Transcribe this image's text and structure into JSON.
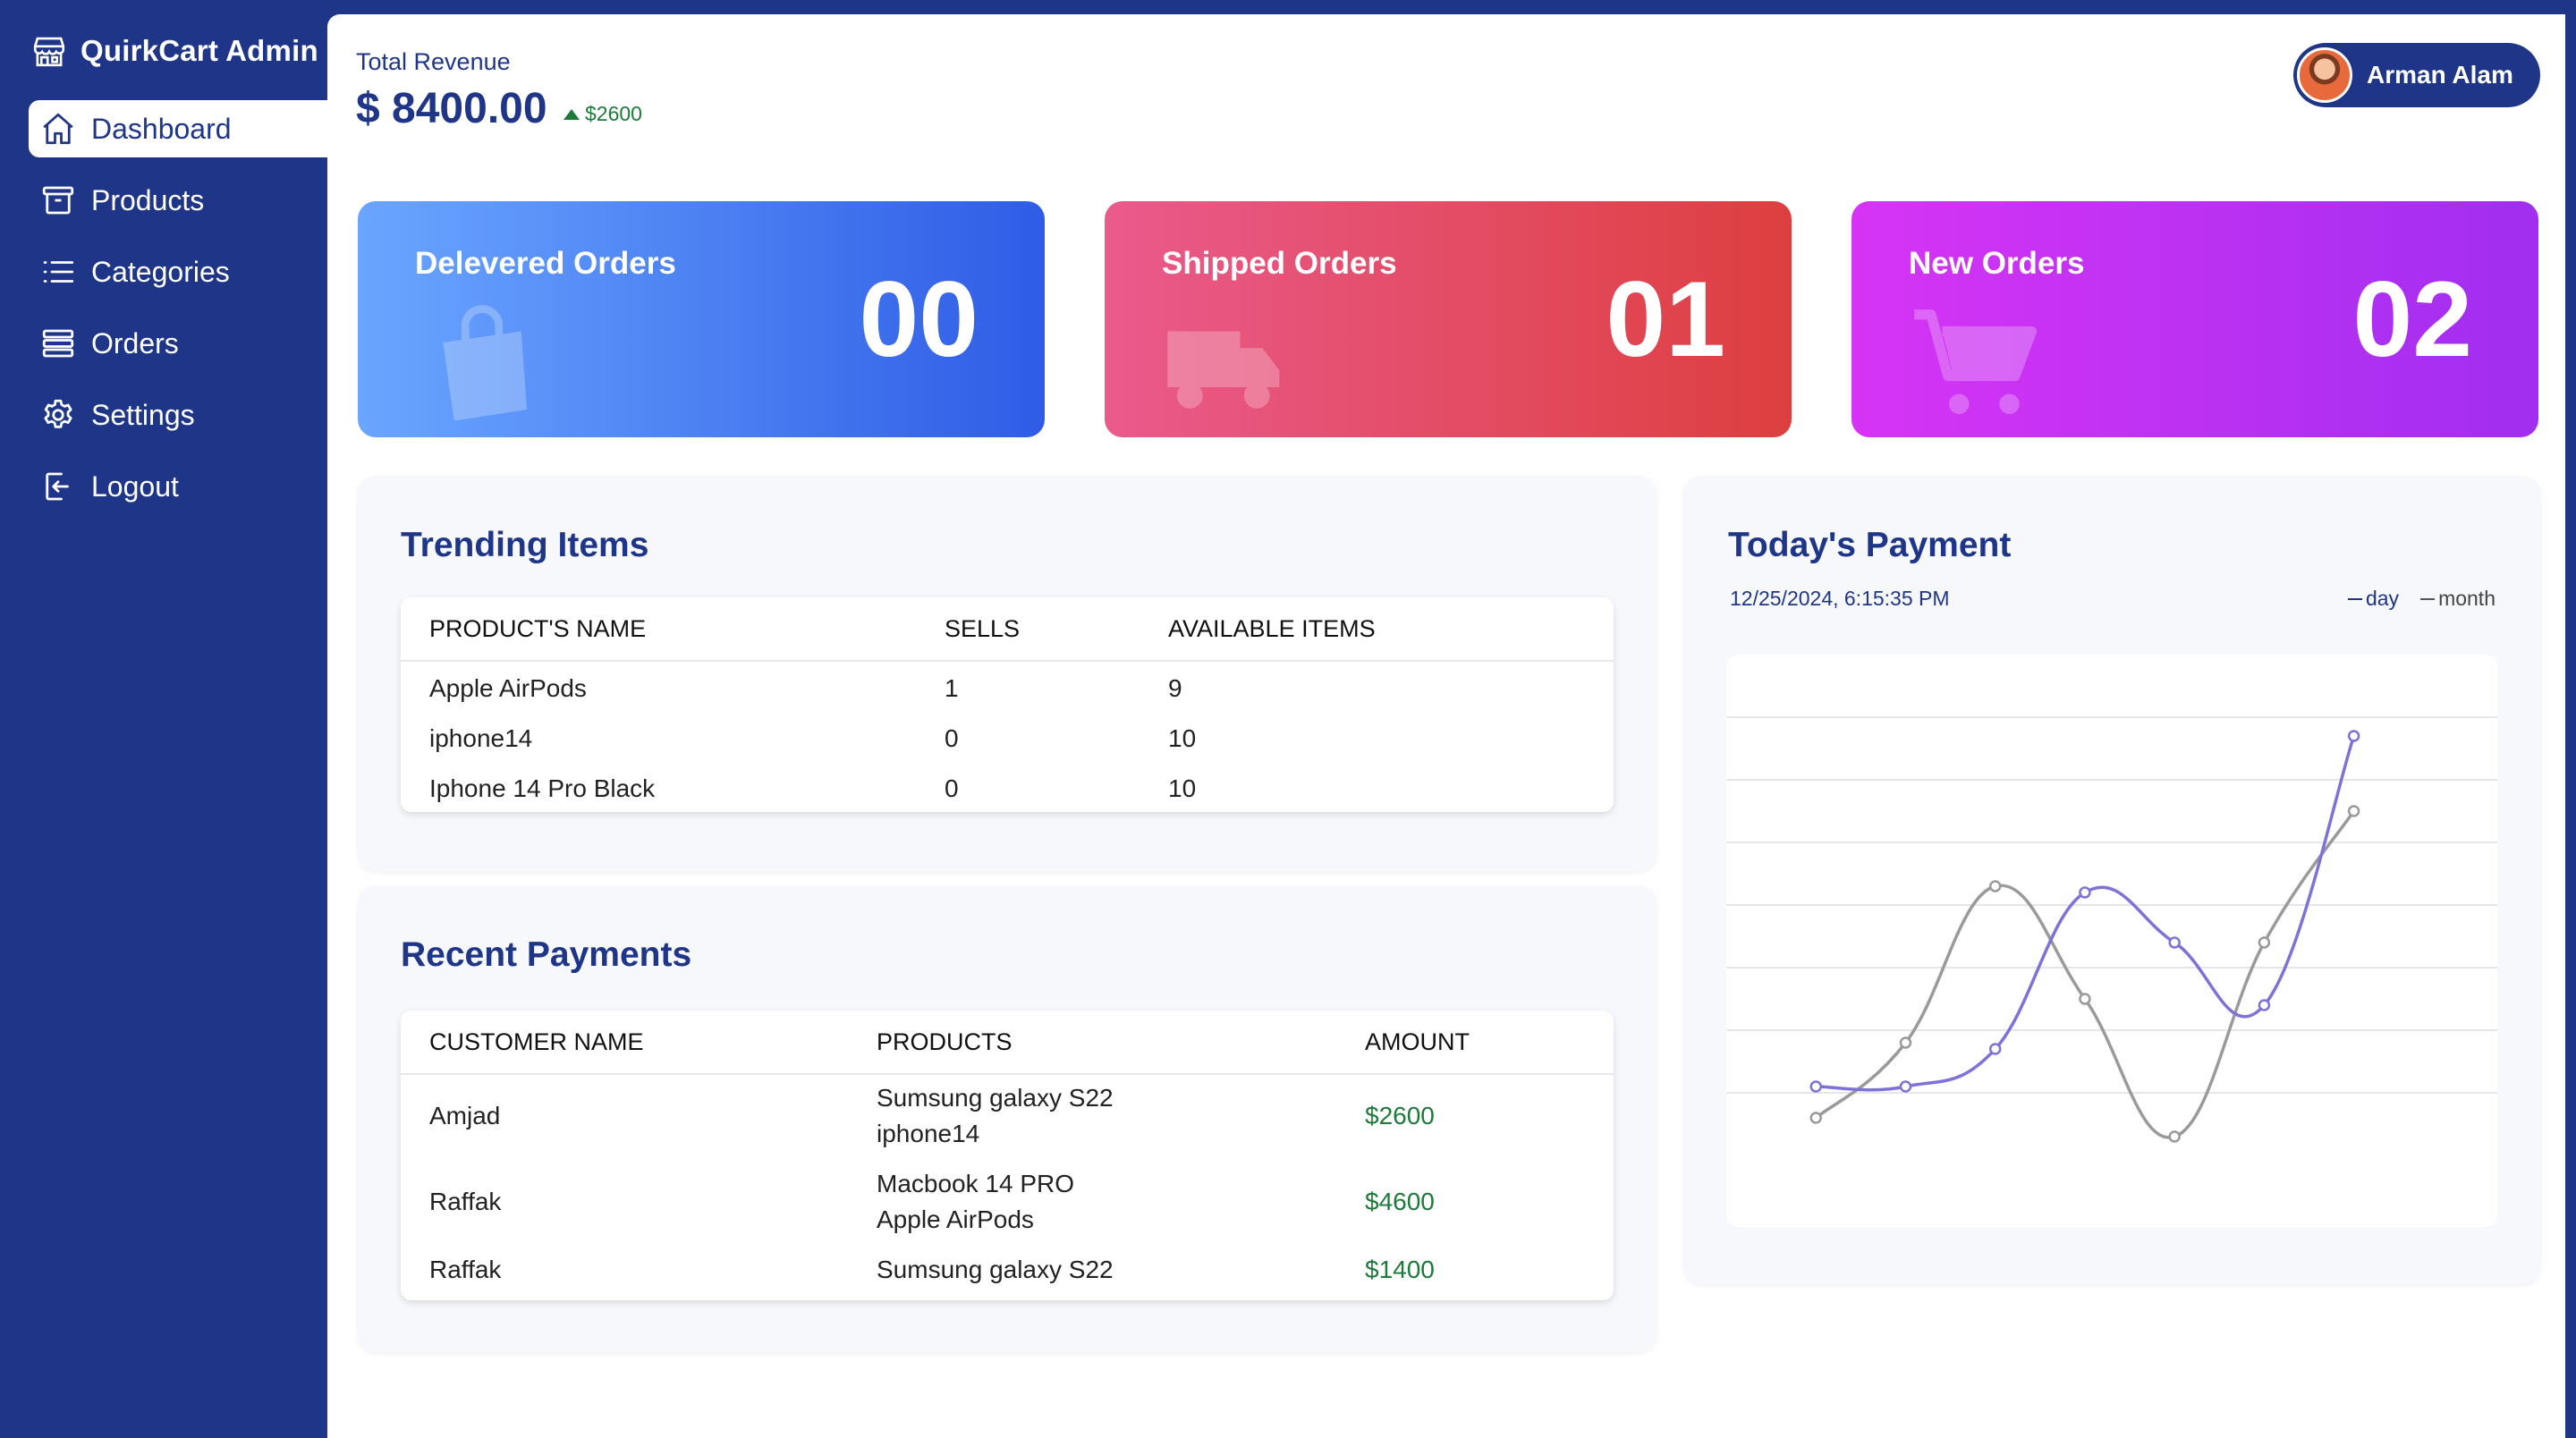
{
  "app": {
    "title": "QuirkCart Admin"
  },
  "sidebar": {
    "items": [
      {
        "label": "Dashboard",
        "icon": "home-icon",
        "active": true
      },
      {
        "label": "Products",
        "icon": "archive-box-icon",
        "active": false
      },
      {
        "label": "Categories",
        "icon": "list-icon",
        "active": false
      },
      {
        "label": "Orders",
        "icon": "stack-icon",
        "active": false
      },
      {
        "label": "Settings",
        "icon": "gear-icon",
        "active": false
      },
      {
        "label": "Logout",
        "icon": "logout-icon",
        "active": false
      }
    ]
  },
  "header": {
    "revenue_label": "Total Revenue",
    "revenue_value": "$ 8400.00",
    "revenue_delta": "$2600",
    "user_name": "Arman Alam"
  },
  "cards": [
    {
      "title": "Delevered Orders",
      "value": "00",
      "icon": "shopping-bag-icon"
    },
    {
      "title": "Shipped Orders",
      "value": "01",
      "icon": "truck-icon"
    },
    {
      "title": "New Orders",
      "value": "02",
      "icon": "cart-icon"
    }
  ],
  "trending": {
    "title": "Trending Items",
    "headers": [
      "PRODUCT'S NAME",
      "SELLS",
      "AVAILABLE ITEMS"
    ],
    "rows": [
      [
        "Apple AirPods",
        "1",
        "9"
      ],
      [
        "iphone14",
        "0",
        "10"
      ],
      [
        "Iphone 14 Pro Black",
        "0",
        "10"
      ]
    ]
  },
  "payments": {
    "title": "Recent Payments",
    "headers": [
      "CUSTOMER NAME",
      "PRODUCTS",
      "AMOUNT"
    ],
    "rows": [
      {
        "customer": "Amjad",
        "products": [
          "Sumsung galaxy S22",
          "iphone14"
        ],
        "amount": "$2600"
      },
      {
        "customer": "Raffak",
        "products": [
          "Macbook 14 PRO",
          "Apple AirPods"
        ],
        "amount": "$4600"
      },
      {
        "customer": "Raffak",
        "products": [
          "Sumsung galaxy S22"
        ],
        "amount": "$1400"
      }
    ]
  },
  "today": {
    "title": "Today's Payment",
    "datetime": "12/25/2024, 6:15:35 PM",
    "legend": {
      "day": "day",
      "month": "month"
    }
  },
  "colors": {
    "brand": "#1f3688",
    "day_line": "#7c72d8",
    "month_line": "#9a9a9a",
    "amount_green": "#1d7a3a"
  },
  "chart_data": {
    "type": "line",
    "x": [
      1,
      2,
      3,
      4,
      5,
      6,
      7
    ],
    "series": [
      {
        "name": "day",
        "values": [
          1.1,
          1.1,
          1.7,
          4.2,
          3.4,
          2.4,
          6.7
        ]
      },
      {
        "name": "month",
        "values": [
          0.6,
          1.8,
          4.3,
          2.5,
          0.3,
          3.4,
          5.5
        ]
      }
    ],
    "ylim": [
      0,
      8
    ],
    "grid": true,
    "legend": "top-right"
  }
}
